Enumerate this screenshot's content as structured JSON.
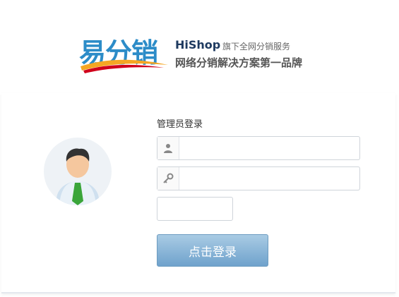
{
  "logo": {
    "brand": "易分销",
    "hishop": "HiShop",
    "tagline_small": "旗下全网分销服务",
    "tagline_big": "网络分销解决方案第一品牌"
  },
  "login": {
    "title": "管理员登录",
    "username_value": "",
    "password_value": "",
    "captcha_value": "",
    "button_label": "点击登录"
  },
  "icons": {
    "username": "user-icon",
    "password": "key-icon",
    "avatar": "admin-avatar"
  },
  "colors": {
    "brand_blue": "#2c8cc8",
    "button_top": "#a9cbe4",
    "button_bottom": "#6fa2cc"
  }
}
